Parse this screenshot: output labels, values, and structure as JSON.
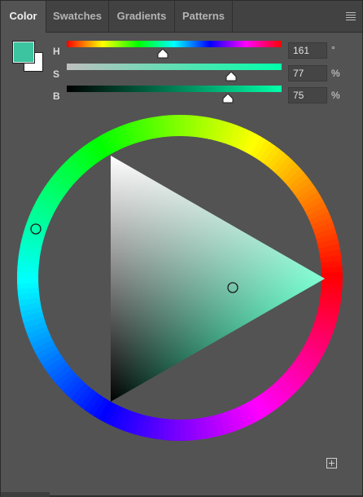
{
  "tabs": [
    {
      "label": "Color",
      "active": true
    },
    {
      "label": "Swatches",
      "active": false
    },
    {
      "label": "Gradients",
      "active": false
    },
    {
      "label": "Patterns",
      "active": false
    }
  ],
  "colors": {
    "foreground": "#3bc49f",
    "background": "#ffffff",
    "hue_color": "#00ffaa"
  },
  "sliders": {
    "h": {
      "label": "H",
      "value": "161",
      "unit": "°"
    },
    "s": {
      "label": "S",
      "value": "77",
      "unit": "%"
    },
    "b": {
      "label": "B",
      "value": "75",
      "unit": "%"
    }
  },
  "icons": {
    "menu": "hamburger-menu-icon",
    "add": "add-swatch-icon"
  }
}
